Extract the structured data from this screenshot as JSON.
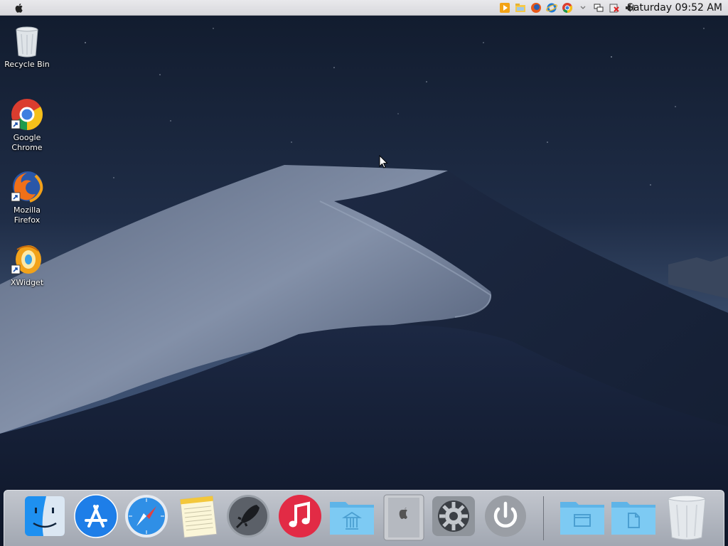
{
  "menubar": {
    "apple_icon": "apple-icon",
    "tray_icons": [
      "media-player-icon",
      "file-explorer-icon",
      "firefox-icon",
      "internet-explorer-icon",
      "chrome-icon",
      "chevron-icon",
      "network-icon",
      "removable-drive-icon",
      "volume-icon"
    ],
    "clock": "Saturday 09:52 AM"
  },
  "desktop": {
    "icons": [
      {
        "label": "Recycle Bin",
        "icon": "recycle-bin-icon"
      },
      {
        "label": "Google Chrome",
        "icon": "chrome-icon"
      },
      {
        "label": "Mozilla Firefox",
        "icon": "firefox-icon"
      },
      {
        "label": "XWidget",
        "icon": "xwidget-icon"
      }
    ]
  },
  "dock": {
    "items": [
      {
        "name": "finder",
        "icon": "finder-icon"
      },
      {
        "name": "app-store",
        "icon": "app-store-icon"
      },
      {
        "name": "safari",
        "icon": "safari-icon"
      },
      {
        "name": "notes",
        "icon": "notes-icon"
      },
      {
        "name": "launchpad",
        "icon": "rocket-icon"
      },
      {
        "name": "itunes",
        "icon": "music-note-icon"
      },
      {
        "name": "applications-folder",
        "icon": "applications-folder-icon"
      },
      {
        "name": "mac-pro",
        "icon": "mac-pro-icon"
      },
      {
        "name": "system-preferences",
        "icon": "gear-icon"
      },
      {
        "name": "shutdown",
        "icon": "power-icon"
      },
      {
        "name": "documents-folder",
        "icon": "folder-icon"
      },
      {
        "name": "downloads-folder",
        "icon": "file-folder-icon"
      },
      {
        "name": "trash",
        "icon": "trash-icon"
      }
    ]
  },
  "colors": {
    "sky": "#1c2a42",
    "dune_light": "#7d8aa3",
    "dune_dark": "#1b2740",
    "folder_blue": "#6cc3f2",
    "menubar": "#e2e2e6"
  }
}
